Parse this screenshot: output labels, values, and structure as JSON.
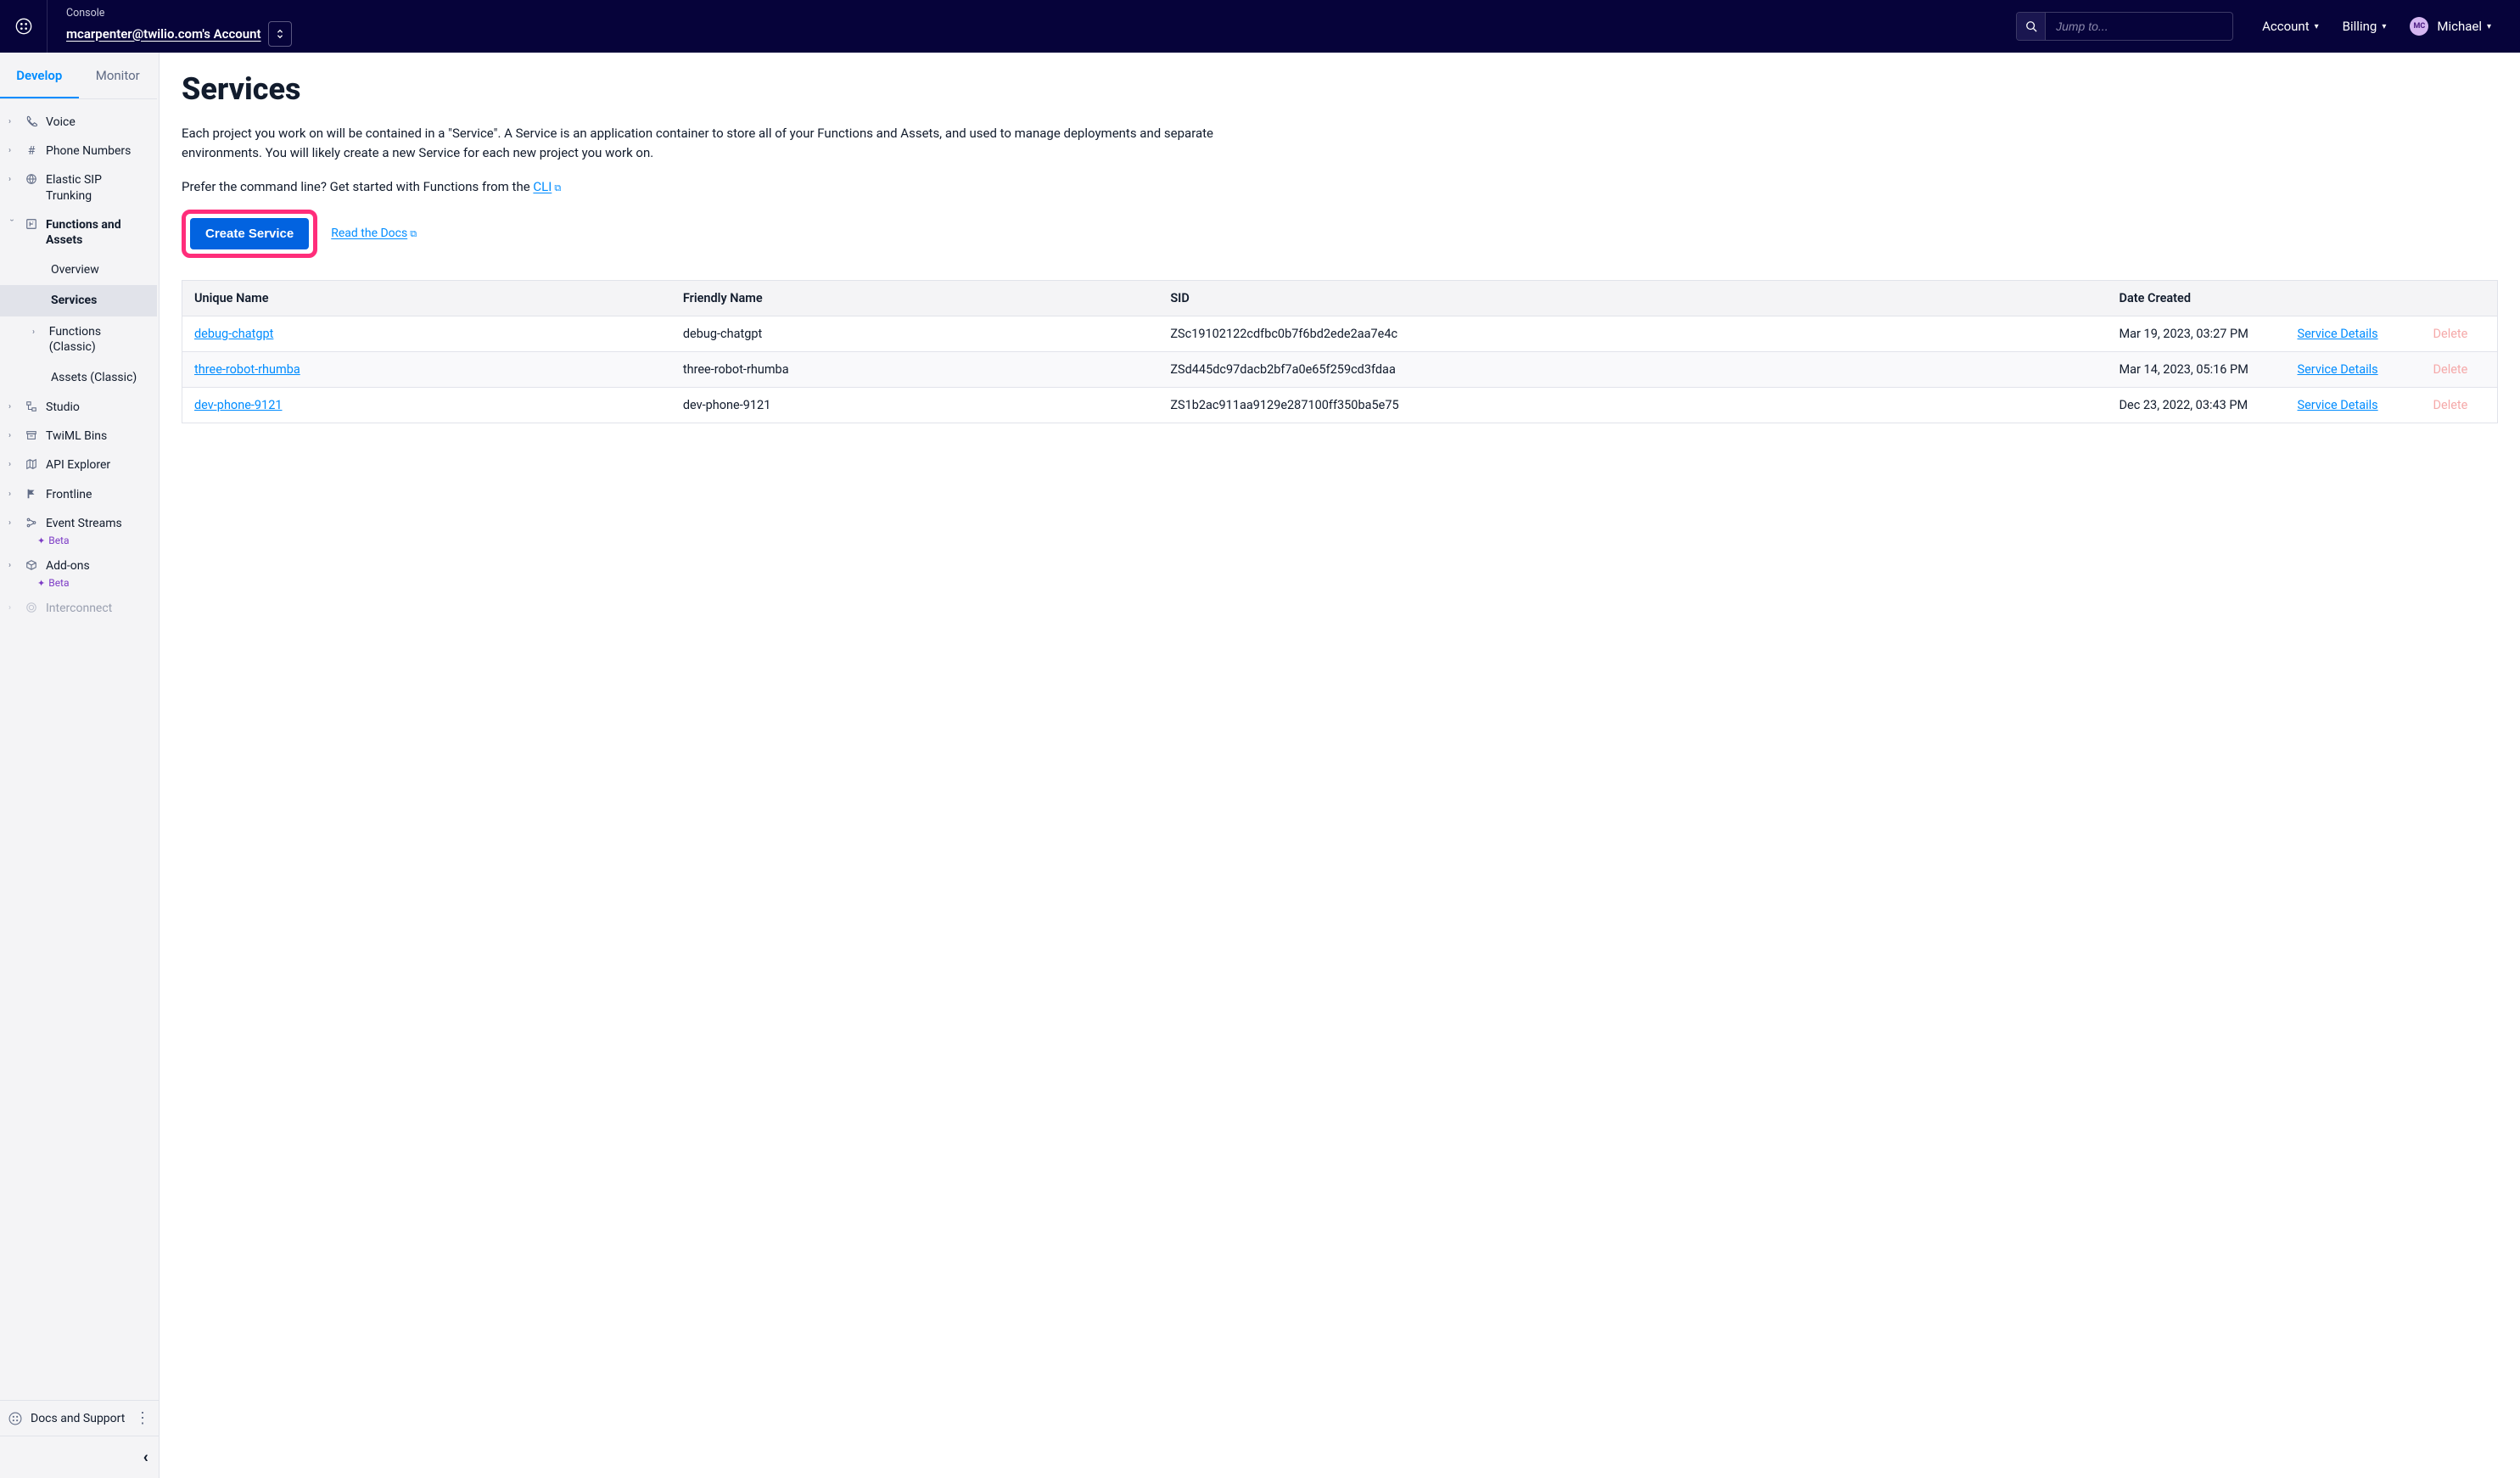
{
  "topbar": {
    "console_label": "Console",
    "account_name": "mcarpenter@twilio.com's Account",
    "search_placeholder": "Jump to...",
    "nav": {
      "account": "Account",
      "billing": "Billing",
      "user_initials": "MC",
      "user_name": "Michael"
    }
  },
  "sidebar": {
    "tabs": {
      "develop": "Develop",
      "monitor": "Monitor"
    },
    "items": {
      "voice": "Voice",
      "phone_numbers": "Phone Numbers",
      "elastic_sip": "Elastic SIP Trunking",
      "functions_assets": "Functions and Assets",
      "studio": "Studio",
      "twiml_bins": "TwiML Bins",
      "api_explorer": "API Explorer",
      "frontline": "Frontline",
      "event_streams": "Event Streams",
      "addons": "Add-ons",
      "interconnect": "Interconnect",
      "beta": "Beta"
    },
    "sub": {
      "overview": "Overview",
      "services": "Services",
      "functions_classic": "Functions (Classic)",
      "assets_classic": "Assets (Classic)"
    },
    "docs_support": "Docs and Support"
  },
  "main": {
    "title": "Services",
    "desc": "Each project you work on will be contained in a \"Service\". A Service is an application container to store all of your Functions and Assets, and used to manage deployments and separate environments. You will likely create a new Service for each new project you work on.",
    "cli_prefix": "Prefer the command line? Get started with Functions from the ",
    "cli_link": "CLI",
    "create_button": "Create Service",
    "read_docs": "Read the Docs",
    "columns": {
      "unique": "Unique Name",
      "friendly": "Friendly Name",
      "sid": "SID",
      "date": "Date Created"
    },
    "service_details": "Service Details",
    "delete_text": "Delete",
    "rows": [
      {
        "unique": "debug-chatgpt",
        "friendly": "debug-chatgpt",
        "sid": "ZSc19102122cdfbc0b7f6bd2ede2aa7e4c",
        "date": "Mar 19, 2023, 03:27 PM"
      },
      {
        "unique": "three-robot-rhumba",
        "friendly": "three-robot-rhumba",
        "sid": "ZSd445dc97dacb2bf7a0e65f259cd3fdaa",
        "date": "Mar 14, 2023, 05:16 PM"
      },
      {
        "unique": "dev-phone-9121",
        "friendly": "dev-phone-9121",
        "sid": "ZS1b2ac911aa9129e287100ff350ba5e75",
        "date": "Dec 23, 2022, 03:43 PM"
      }
    ]
  }
}
